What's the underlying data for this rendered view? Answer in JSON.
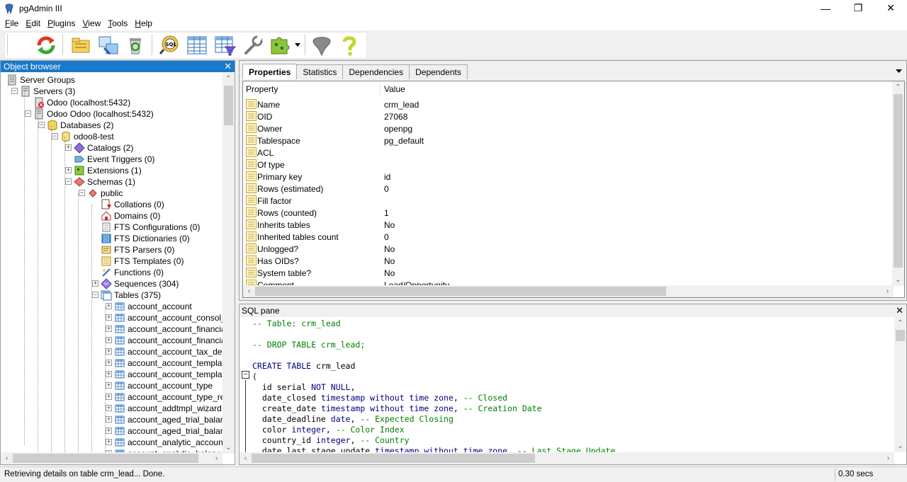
{
  "window": {
    "title": "pgAdmin III",
    "minimize": "—",
    "maximize": "❐",
    "close": "✕"
  },
  "menu": [
    {
      "u": "F",
      "rest": "ile"
    },
    {
      "u": "E",
      "rest": "dit"
    },
    {
      "u": "P",
      "rest": "lugins"
    },
    {
      "u": "V",
      "rest": "iew"
    },
    {
      "u": "T",
      "rest": "ools"
    },
    {
      "u": "H",
      "rest": "elp"
    }
  ],
  "toolbar": {
    "icons": [
      "refresh-icon",
      "object-folder-icon",
      "object-properties-icon",
      "delete-icon",
      "sql-query-icon",
      "view-data-icon",
      "filtered-data-icon",
      "maintenance-wrench-icon",
      "plugins-icon",
      "guru-hint-icon",
      "help-icon"
    ]
  },
  "object_browser": {
    "title": "Object browser",
    "close": "✕",
    "tree": [
      {
        "label": "Server Groups",
        "indent": 0,
        "icon": "server-groups-icon",
        "exp": ""
      },
      {
        "label": "Servers (3)",
        "indent": 1,
        "icon": "servers-icon",
        "exp": "-"
      },
      {
        "label": "Odoo (localhost:5432)",
        "indent": 2,
        "icon": "server-disconnected-icon",
        "exp": ""
      },
      {
        "label": "Odoo Odoo (localhost:5432)",
        "indent": 2,
        "icon": "server-icon",
        "exp": "-"
      },
      {
        "label": "Databases (2)",
        "indent": 3,
        "icon": "databases-icon",
        "exp": "-"
      },
      {
        "label": "odoo8-test",
        "indent": 4,
        "icon": "database-icon",
        "exp": "-"
      },
      {
        "label": "Catalogs (2)",
        "indent": 5,
        "icon": "catalogs-icon",
        "exp": "+"
      },
      {
        "label": "Event Triggers (0)",
        "indent": 5,
        "icon": "event-triggers-icon",
        "exp": ""
      },
      {
        "label": "Extensions (1)",
        "indent": 5,
        "icon": "extensions-icon",
        "exp": "+"
      },
      {
        "label": "Schemas (1)",
        "indent": 5,
        "icon": "schemas-icon",
        "exp": "-"
      },
      {
        "label": "public",
        "indent": 6,
        "icon": "schema-icon",
        "exp": "-"
      },
      {
        "label": "Collations (0)",
        "indent": 7,
        "icon": "collations-icon",
        "exp": ""
      },
      {
        "label": "Domains (0)",
        "indent": 7,
        "icon": "domains-icon",
        "exp": ""
      },
      {
        "label": "FTS Configurations (0)",
        "indent": 7,
        "icon": "fts-configurations-icon",
        "exp": ""
      },
      {
        "label": "FTS Dictionaries (0)",
        "indent": 7,
        "icon": "fts-dictionaries-icon",
        "exp": ""
      },
      {
        "label": "FTS Parsers (0)",
        "indent": 7,
        "icon": "fts-parsers-icon",
        "exp": ""
      },
      {
        "label": "FTS Templates (0)",
        "indent": 7,
        "icon": "fts-templates-icon",
        "exp": ""
      },
      {
        "label": "Functions (0)",
        "indent": 7,
        "icon": "functions-icon",
        "exp": ""
      },
      {
        "label": "Sequences (304)",
        "indent": 7,
        "icon": "sequences-icon",
        "exp": "+"
      },
      {
        "label": "Tables (375)",
        "indent": 7,
        "icon": "tables-icon",
        "exp": "-"
      },
      {
        "label": "account_account",
        "indent": 8,
        "icon": "table-icon",
        "exp": "+"
      },
      {
        "label": "account_account_consol_rel",
        "indent": 8,
        "icon": "table-icon",
        "exp": "+"
      },
      {
        "label": "account_account_financial_r",
        "indent": 8,
        "icon": "table-icon",
        "exp": "+"
      },
      {
        "label": "account_account_financial_r",
        "indent": 8,
        "icon": "table-icon",
        "exp": "+"
      },
      {
        "label": "account_account_tax_defau",
        "indent": 8,
        "icon": "table-icon",
        "exp": "+"
      },
      {
        "label": "account_account_template",
        "indent": 8,
        "icon": "table-icon",
        "exp": "+"
      },
      {
        "label": "account_account_template_",
        "indent": 8,
        "icon": "table-icon",
        "exp": "+"
      },
      {
        "label": "account_account_type",
        "indent": 8,
        "icon": "table-icon",
        "exp": "+"
      },
      {
        "label": "account_account_type_rel",
        "indent": 8,
        "icon": "table-icon",
        "exp": "+"
      },
      {
        "label": "account_addtmpl_wizard",
        "indent": 8,
        "icon": "table-icon",
        "exp": "+"
      },
      {
        "label": "account_aged_trial_balance",
        "indent": 8,
        "icon": "table-icon",
        "exp": "+"
      },
      {
        "label": "account_aged_trial_balance",
        "indent": 8,
        "icon": "table-icon",
        "exp": "+"
      },
      {
        "label": "account_analytic_account",
        "indent": 8,
        "icon": "table-icon",
        "exp": "+"
      },
      {
        "label": "account_analytic_balance",
        "indent": 8,
        "icon": "table-icon",
        "exp": "+"
      }
    ]
  },
  "properties": {
    "tabs": [
      "Properties",
      "Statistics",
      "Dependencies",
      "Dependents"
    ],
    "active_tab": "Properties",
    "header": {
      "property": "Property",
      "value": "Value"
    },
    "rows": [
      {
        "name": "Name",
        "value": "crm_lead"
      },
      {
        "name": "OID",
        "value": "27068"
      },
      {
        "name": "Owner",
        "value": "openpg"
      },
      {
        "name": "Tablespace",
        "value": "pg_default"
      },
      {
        "name": "ACL",
        "value": ""
      },
      {
        "name": "Of type",
        "value": ""
      },
      {
        "name": "Primary key",
        "value": "id"
      },
      {
        "name": "Rows (estimated)",
        "value": "0"
      },
      {
        "name": "Fill factor",
        "value": ""
      },
      {
        "name": "Rows (counted)",
        "value": "1"
      },
      {
        "name": "Inherits tables",
        "value": "No"
      },
      {
        "name": "Inherited tables count",
        "value": "0"
      },
      {
        "name": "Unlogged?",
        "value": "No"
      },
      {
        "name": "Has OIDs?",
        "value": "No"
      },
      {
        "name": "System table?",
        "value": "No"
      },
      {
        "name": "Comment",
        "value": "Lead/Opportunity"
      }
    ]
  },
  "sql_pane": {
    "title": "SQL pane",
    "close": "✕",
    "lines": [
      [
        {
          "t": "-- Table: crm_lead",
          "c": "cm"
        }
      ],
      [],
      [
        {
          "t": "-- DROP TABLE crm_lead;",
          "c": "cm"
        }
      ],
      [],
      [
        {
          "t": "CREATE TABLE ",
          "c": "kw"
        },
        {
          "t": "crm_lead",
          "c": ""
        }
      ],
      [
        {
          "t": "(",
          "c": ""
        }
      ],
      [
        {
          "t": "  id serial ",
          "c": ""
        },
        {
          "t": "NOT NULL",
          "c": "kw"
        },
        {
          "t": ",",
          "c": ""
        }
      ],
      [
        {
          "t": "  date_closed ",
          "c": ""
        },
        {
          "t": "timestamp without time zone",
          "c": "kw"
        },
        {
          "t": ", ",
          "c": ""
        },
        {
          "t": "-- Closed",
          "c": "cm"
        }
      ],
      [
        {
          "t": "  create_date ",
          "c": ""
        },
        {
          "t": "timestamp without time zone",
          "c": "kw"
        },
        {
          "t": ", ",
          "c": ""
        },
        {
          "t": "-- Creation Date",
          "c": "cm"
        }
      ],
      [
        {
          "t": "  date_deadline ",
          "c": ""
        },
        {
          "t": "date",
          "c": "kw"
        },
        {
          "t": ", ",
          "c": ""
        },
        {
          "t": "-- Expected Closing",
          "c": "cm"
        }
      ],
      [
        {
          "t": "  color ",
          "c": ""
        },
        {
          "t": "integer",
          "c": "kw"
        },
        {
          "t": ", ",
          "c": ""
        },
        {
          "t": "-- Color Index",
          "c": "cm"
        }
      ],
      [
        {
          "t": "  country_id ",
          "c": ""
        },
        {
          "t": "integer",
          "c": "kw"
        },
        {
          "t": ", ",
          "c": ""
        },
        {
          "t": "-- Country",
          "c": "cm"
        }
      ],
      [
        {
          "t": "  date_last_stage_update ",
          "c": ""
        },
        {
          "t": "timestamp without time zone",
          "c": "kw"
        },
        {
          "t": ", ",
          "c": ""
        },
        {
          "t": "-- Last Stage Update",
          "c": "cm"
        }
      ]
    ]
  },
  "status": {
    "message": "Retrieving details on table crm_lead... Done.",
    "time": "0.30 secs"
  }
}
